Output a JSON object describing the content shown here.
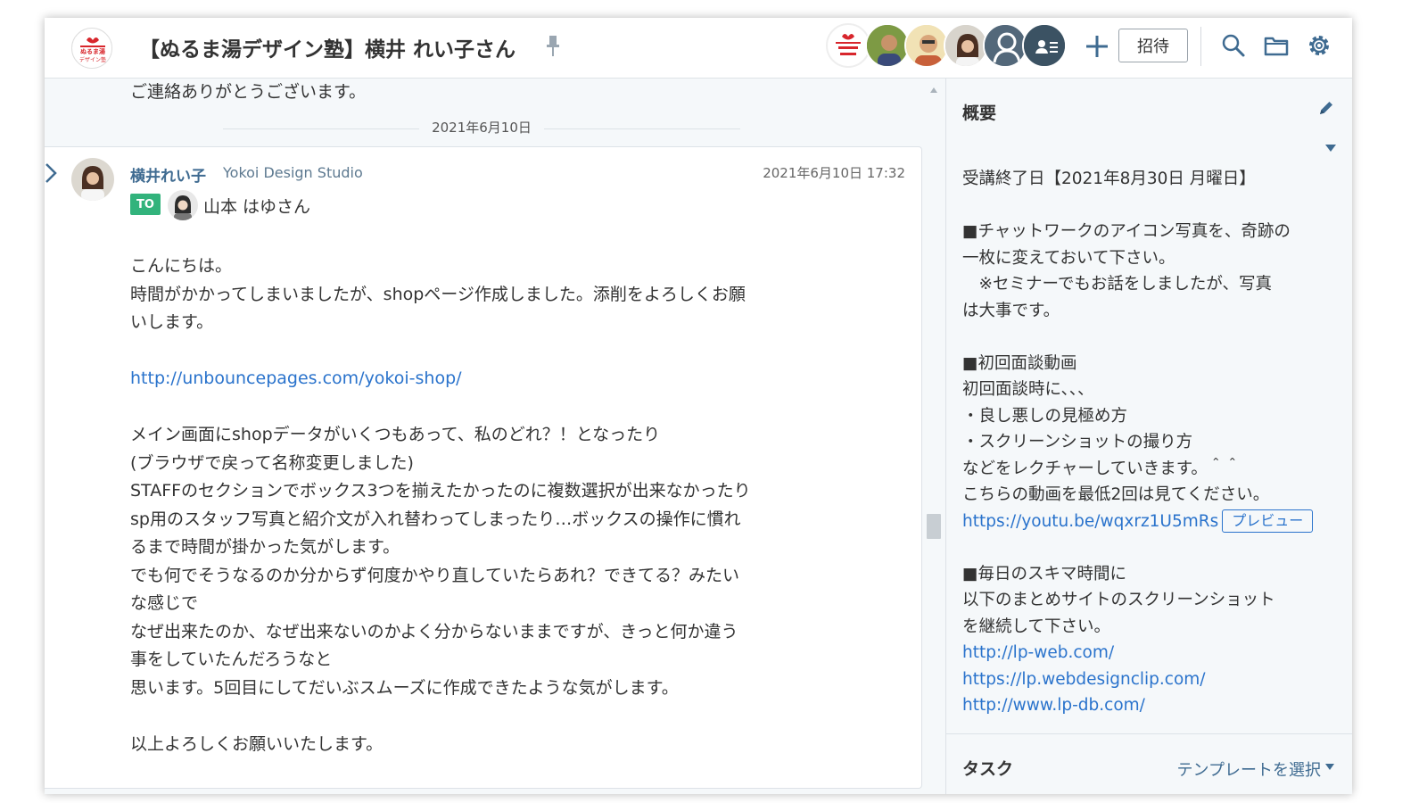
{
  "header": {
    "room_title": "【ぬるま湯デザイン塾】横井 れい子さん",
    "logo_text_top": "ぬるま湯",
    "logo_text_bottom": "デザイン塾",
    "invite_label": "招待",
    "member_count_shown": 6
  },
  "chat": {
    "previous_message_tail": "ご連絡ありがとうございます。",
    "date_separator": "2021年6月10日",
    "message": {
      "sender_name": "横井れい子",
      "sender_org": "Yokoi Design Studio",
      "timestamp": "2021年6月10日 17:32",
      "to_label": "TO",
      "to_name": "山本 はゆさん",
      "body_before_link": "こんにちは。\n時間がかかってしまいましたが、shopページ作成しました。添削をよろしくお願\nいします。\n\n",
      "link": "http://unbouncepages.com/yokoi-shop/",
      "body_after_link": "\n\nメイン画面にshopデータがいくつもあって、私のどれ？！となったり\n(ブラウザで戻って名称変更しました)\nSTAFFのセクションでボックス3つを揃えたかったのに複数選択が出来なかったり\nsp用のスタッフ写真と紹介文が入れ替わってしまったり…ボックスの操作に慣れ\nるまで時間が掛かった気がします。\nでも何でそうなるのか分からず何度かやり直していたらあれ？できてる？みたい\nな感じで\nなぜ出来たのか、なぜ出来ないのかよく分からないままですが、きっと何か違う\n事をしていたんだろうなと\n思います。5回目にしてだいぶスムーズに作成できたような気がします。\n\n以上よろしくお願いいたします。"
    }
  },
  "sidebar": {
    "overview_title": "概要",
    "overview_text_1": "受講終了日【2021年8月30日 月曜日】\n\n■チャットワークのアイコン写真を、奇跡の\n一枚に変えておいて下さい。\n　※セミナーでもお話をしましたが、写真\nは大事です。\n\n■初回面談動画\n初回面談時に、、、\n・良し悪しの見極め方\n・スクリーンショットの撮り方\nなどをレクチャーしていきます。＾＾\nこちらの動画を最低2回は見てください。\n",
    "video_link": "https://youtu.be/wqxrz1U5mRs",
    "preview_label": "プレビュー",
    "overview_text_2": "\n\n■毎日のスキマ時間に\n以下のまとめサイトのスクリーンショット\nを継続して下さい。\n",
    "site_link_1": "http://lp-web.com/",
    "site_link_2": "https://lp.webdesignclip.com/",
    "site_link_3": "http://www.lp-db.com/",
    "task_title": "タスク",
    "template_label": "テンプレートを選択"
  },
  "colors": {
    "accent_blue": "#2a73cc",
    "name_blue": "#3f6b91",
    "to_green": "#32b37c",
    "panel_bg": "#f5f8fa"
  }
}
